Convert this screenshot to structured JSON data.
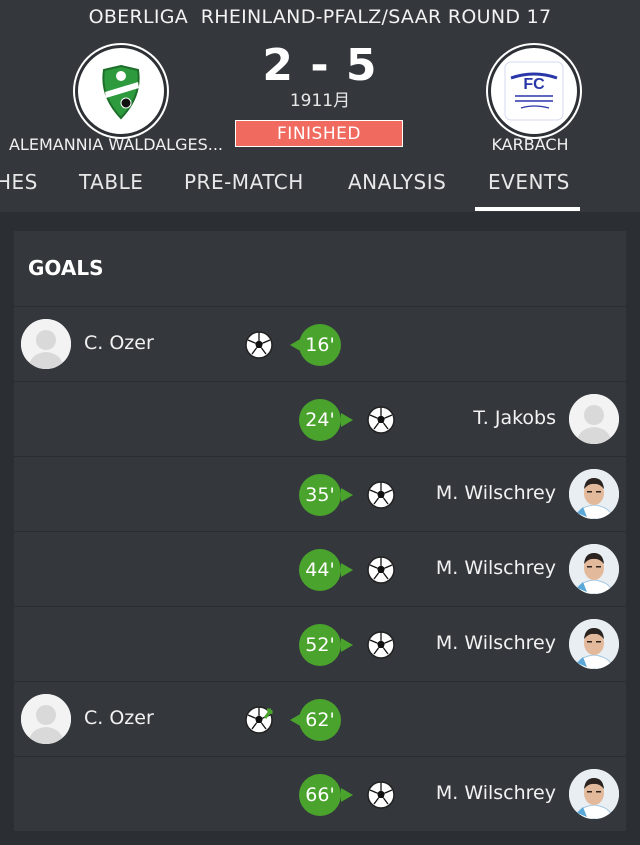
{
  "header": {
    "league_title": "OBERLIGA  RHEINLAND-PFALZ/SAAR ROUND 17",
    "home_team": "ALEMANNIA WALDALGES...",
    "away_team": "KARBACH",
    "score": "2 - 5",
    "date": "1911月",
    "status": "FINISHED"
  },
  "tabs": [
    {
      "label": "HES"
    },
    {
      "label": "TABLE"
    },
    {
      "label": "PRE-MATCH"
    },
    {
      "label": "ANALYSIS"
    },
    {
      "label": "EVENTS"
    }
  ],
  "active_tab": "EVENTS",
  "goals": {
    "title": "GOALS",
    "events": [
      {
        "minute": "16'",
        "player": "C. Ozer",
        "side": "home"
      },
      {
        "minute": "24'",
        "player": "T. Jakobs",
        "side": "away"
      },
      {
        "minute": "35'",
        "player": "M. Wilschrey",
        "side": "away"
      },
      {
        "minute": "44'",
        "player": "M. Wilschrey",
        "side": "away"
      },
      {
        "minute": "52'",
        "player": "M. Wilschrey",
        "side": "away"
      },
      {
        "minute": "62'",
        "player": "C. Ozer",
        "side": "home"
      },
      {
        "minute": "66'",
        "player": "M. Wilschrey",
        "side": "away"
      }
    ]
  },
  "colors": {
    "minute_badge": "#49a32d",
    "status_badge": "#f06a5f",
    "header_bg": "#34383c",
    "page_bg": "#2b2f33"
  }
}
